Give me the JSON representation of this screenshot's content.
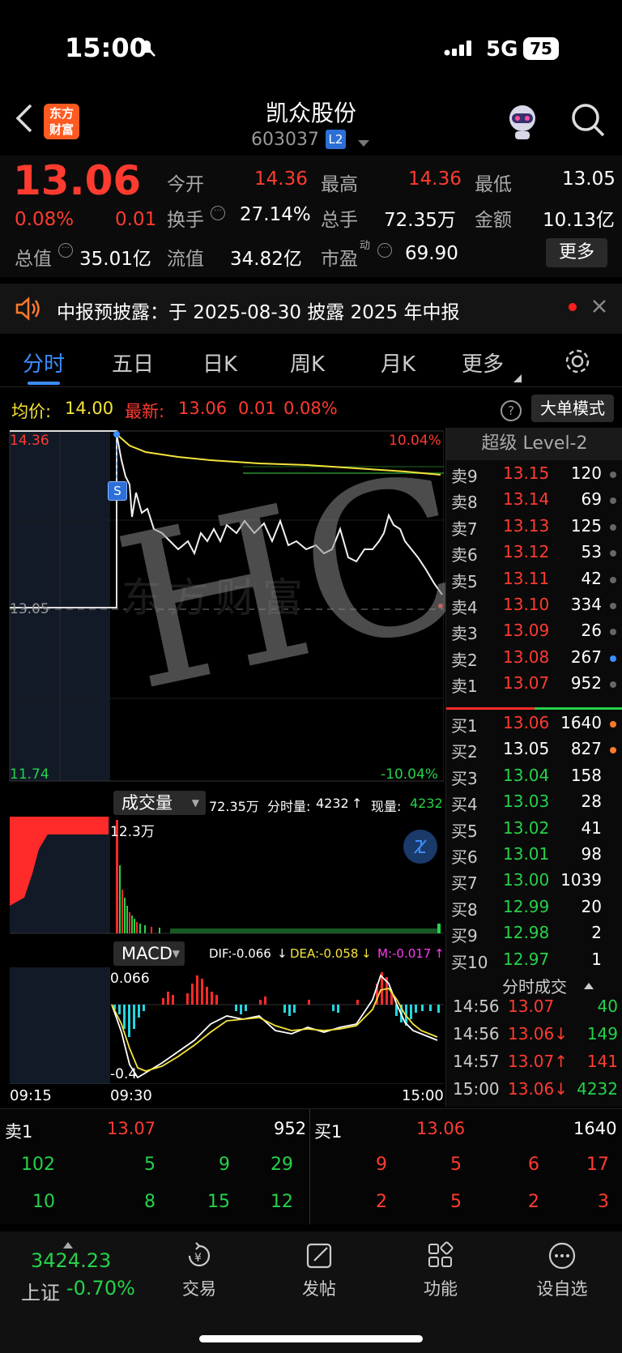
{
  "status_bar": {
    "time": "15:00",
    "network": "5G",
    "battery": "75"
  },
  "header": {
    "app_logo_line1": "东方",
    "app_logo_line2": "财富",
    "stock_name": "凯众股份",
    "stock_code": "603037",
    "level_badge": "L2"
  },
  "quote": {
    "price": "13.06",
    "change_pct": "0.08%",
    "change": "0.01",
    "open_label": "今开",
    "open": "14.36",
    "high_label": "最高",
    "high": "14.36",
    "low_label": "最低",
    "low": "13.05",
    "turnover_label": "换手",
    "turnover": "27.14%",
    "volume_label": "总手",
    "volume": "72.35万",
    "amount_label": "金额",
    "amount": "10.13亿",
    "mktcap_label": "总值",
    "mktcap": "35.01亿",
    "float_label": "流值",
    "float": "34.82亿",
    "pe_label": "市盈",
    "pe_sup": "动",
    "pe": "69.90",
    "more_button": "更多"
  },
  "notice": {
    "text": "中报预披露：于 2025-08-30 披露 2025 年中报"
  },
  "tabs": [
    "分时",
    "五日",
    "日K",
    "周K",
    "月K",
    "更多"
  ],
  "info_line": {
    "avg_label": "均价:",
    "avg": "14.00",
    "latest_label": "最新:",
    "latest": "13.06",
    "latest_change": "0.01",
    "latest_pct": "0.08%",
    "big_order_mode": "大单模式"
  },
  "price_chart": {
    "top_price": "14.36",
    "mid_price": "13.05",
    "bottom_price": "11.74",
    "top_pct": "10.04%",
    "bottom_pct": "-10.04%",
    "s_marker": "S"
  },
  "volume_panel": {
    "label": "成交量",
    "total": "72.35万",
    "period_label": "分时量:",
    "period_value": "4232",
    "current_label": "现量:",
    "current_value": "4232",
    "max_label": "12.3万"
  },
  "macd_panel": {
    "label": "MACD",
    "dif": "DIF:-0.066",
    "dea": "DEA:-0.058",
    "m": "M:-0.017",
    "top": "0.066",
    "bottom": "-0.4",
    "time_start": "09:15",
    "time_open": "09:30",
    "time_end": "15:00"
  },
  "order_book": {
    "title": "超级 Level-2",
    "asks": [
      {
        "label": "卖9",
        "price": "13.15",
        "vol": "120"
      },
      {
        "label": "卖8",
        "price": "13.14",
        "vol": "69"
      },
      {
        "label": "卖7",
        "price": "13.13",
        "vol": "125"
      },
      {
        "label": "卖6",
        "price": "13.12",
        "vol": "53"
      },
      {
        "label": "卖5",
        "price": "13.11",
        "vol": "42"
      },
      {
        "label": "卖4",
        "price": "13.10",
        "vol": "334"
      },
      {
        "label": "卖3",
        "price": "13.09",
        "vol": "26"
      },
      {
        "label": "卖2",
        "price": "13.08",
        "vol": "267"
      },
      {
        "label": "卖1",
        "price": "13.07",
        "vol": "952"
      }
    ],
    "bids": [
      {
        "label": "买1",
        "price": "13.06",
        "vol": "1640"
      },
      {
        "label": "买2",
        "price": "13.05",
        "vol": "827"
      },
      {
        "label": "买3",
        "price": "13.04",
        "vol": "158"
      },
      {
        "label": "买4",
        "price": "13.03",
        "vol": "28"
      },
      {
        "label": "买5",
        "price": "13.02",
        "vol": "41"
      },
      {
        "label": "买6",
        "price": "13.01",
        "vol": "98"
      },
      {
        "label": "买7",
        "price": "13.00",
        "vol": "1039"
      },
      {
        "label": "买8",
        "price": "12.99",
        "vol": "20"
      },
      {
        "label": "买9",
        "price": "12.98",
        "vol": "2"
      },
      {
        "label": "买10",
        "price": "12.97",
        "vol": "1"
      }
    ]
  },
  "trades": {
    "title": "分时成交",
    "rows": [
      {
        "time": "14:56",
        "price": "13.07",
        "vol": "40"
      },
      {
        "time": "14:56",
        "price": "13.06↓",
        "vol": "149"
      },
      {
        "time": "14:57",
        "price": "13.07↑",
        "vol": "141"
      },
      {
        "time": "15:00",
        "price": "13.06↓",
        "vol": "4232"
      }
    ]
  },
  "queue": {
    "ask_label": "卖1",
    "ask_price": "13.07",
    "ask_vol": "952",
    "bid_label": "买1",
    "bid_price": "13.06",
    "bid_vol": "1640",
    "ask_row1": [
      "102",
      "5",
      "9",
      "29"
    ],
    "ask_row2": [
      "10",
      "8",
      "15",
      "12"
    ],
    "bid_row1": [
      "9",
      "5",
      "6",
      "17"
    ],
    "bid_row2": [
      "2",
      "5",
      "2",
      "3"
    ]
  },
  "bottom_nav": {
    "index_value": "3424.23",
    "index_name": "上证",
    "index_pct": "-0.70%",
    "items": [
      "交易",
      "发帖",
      "功能",
      "设自选"
    ]
  },
  "watermark": {
    "text": "HC",
    "logo_text": "东方财富"
  }
}
